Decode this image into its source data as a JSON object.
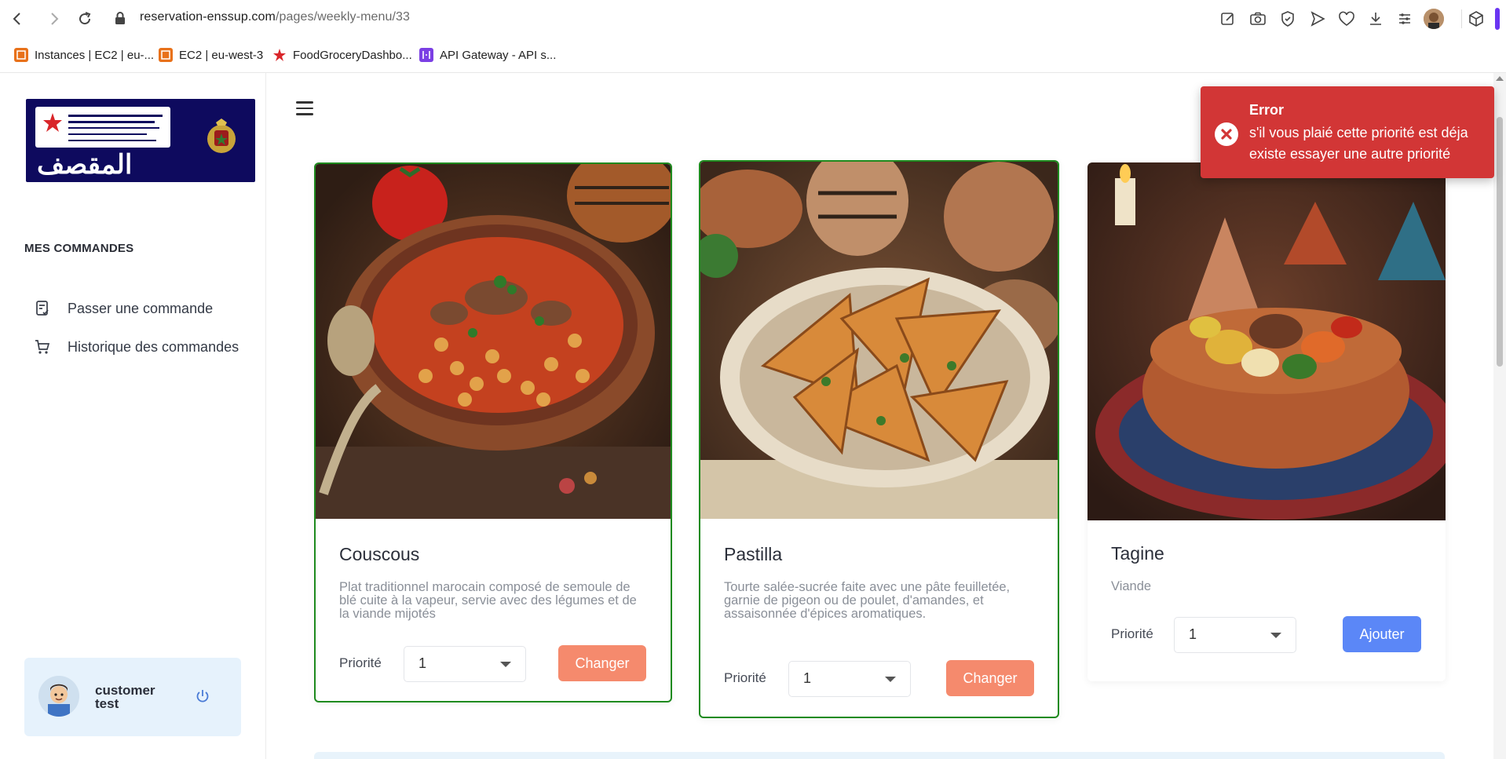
{
  "browser": {
    "url_host": "reservation-enssup.com",
    "url_path": "/pages/weekly-menu/33",
    "bookmarks": [
      {
        "label": "Instances | EC2 | eu-...",
        "color": "#e8711a"
      },
      {
        "label": "EC2 | eu-west-3",
        "color": "#e8711a"
      },
      {
        "label": "FoodGroceryDashbo...",
        "color": "#d9262a"
      },
      {
        "label": "API Gateway - API s...",
        "color": "#7b3fe4"
      }
    ]
  },
  "sidebar": {
    "logo_text": "المقصف",
    "section_title": "MES COMMANDES",
    "items": [
      {
        "label": "Passer une commande",
        "icon": "order-list-icon"
      },
      {
        "label": "Historique des commandes",
        "icon": "cart-icon"
      }
    ],
    "user": {
      "name": "customer test"
    }
  },
  "menu": {
    "cards": [
      {
        "title": "Couscous",
        "description": "Plat traditionnel marocain composé de semoule de blé cuite à la vapeur, servie avec des légumes et de la viande mijotés",
        "priority_label": "Priorité",
        "priority_value": "1",
        "button_label": "Changer",
        "selected": true
      },
      {
        "title": "Pastilla",
        "description": "Tourte salée-sucrée faite avec une pâte feuilletée, garnie de pigeon ou de poulet, d'amandes, et assaisonnée d'épices aromatiques.",
        "priority_label": "Priorité",
        "priority_value": "1",
        "button_label": "Changer",
        "selected": true
      },
      {
        "title": "Tagine",
        "description": "Viande",
        "priority_label": "Priorité",
        "priority_value": "1",
        "button_label": "Ajouter",
        "selected": false
      }
    ]
  },
  "toast": {
    "title": "Error",
    "message": "s'il vous plaié cette priorité est déja existe essayer une autre priorité"
  },
  "colors": {
    "selected_border": "#1e8a1e",
    "change_button": "#f58a6d",
    "add_button": "#5b87f7",
    "error": "#d23636"
  }
}
